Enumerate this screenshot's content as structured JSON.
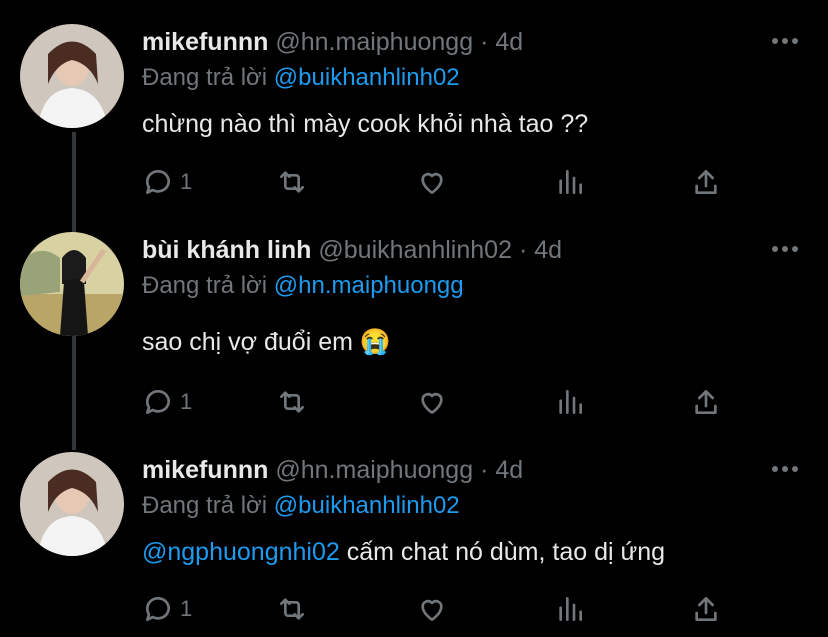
{
  "tweets": [
    {
      "name": "mikefunnn",
      "handle": "@hn.maiphuongg",
      "time": "· 4d",
      "replying_label": "Đang trả lời",
      "replying_to": "@buikhanhlinh02",
      "text_mention": "",
      "text": "chừng nào thì mày cook khỏi nhà tao ??",
      "reply_count": "1"
    },
    {
      "name": "bùi khánh linh",
      "handle": "@buikhanhlinh02",
      "time": "· 4d",
      "replying_label": "Đang trả lời",
      "replying_to": "@hn.maiphuongg",
      "text_mention": "",
      "text": "sao chị vợ đuổi em 😭",
      "reply_count": "1"
    },
    {
      "name": "mikefunnn",
      "handle": "@hn.maiphuongg",
      "time": "· 4d",
      "replying_label": "Đang trả lời",
      "replying_to": "@buikhanhlinh02",
      "text_mention": "@ngphuongnhi02",
      "text": " cấm chat nó dùm, tao dị ứng",
      "reply_count": "1"
    }
  ],
  "icons": [
    "reply-icon",
    "retweet-icon",
    "like-icon",
    "stats-icon",
    "share-icon",
    "more-icon"
  ],
  "colors": {
    "background": "#000000",
    "text": "#e7e9ea",
    "muted": "#71767b",
    "link": "#1d9bf0"
  }
}
